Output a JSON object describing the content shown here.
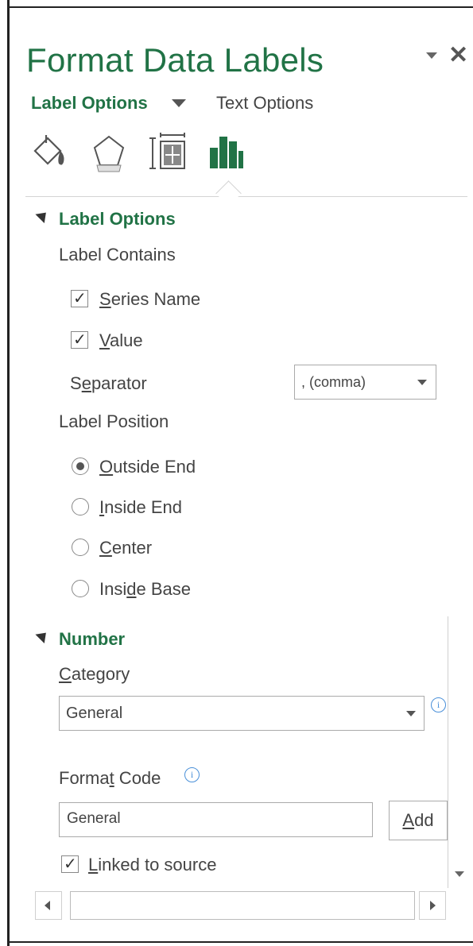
{
  "pane": {
    "title": "Format Data Labels",
    "close_glyph": "✕",
    "dropdown_icon": "chevron-down-icon"
  },
  "tabs": {
    "label_options": "Label Options",
    "text_options": "Text Options"
  },
  "icons": [
    "fill-line-icon",
    "effects-icon",
    "size-properties-icon",
    "label-options-icon"
  ],
  "colors": {
    "accent": "#217346",
    "info": "#4a90d9"
  },
  "label_options_section": {
    "title": "Label Options",
    "label_contains": "Label Contains",
    "series_name": {
      "pre": "",
      "ul": "S",
      "post": "eries Name",
      "checked": true
    },
    "value": {
      "pre": "",
      "ul": "V",
      "post": "alue",
      "checked": true
    },
    "separator": {
      "pre": "S",
      "ul": "e",
      "post": "parator",
      "value": ", (comma)"
    },
    "label_position": "Label Position",
    "positions": [
      {
        "pre": "",
        "ul": "O",
        "post": "utside End",
        "selected": true
      },
      {
        "pre": "",
        "ul": "I",
        "post": "nside End",
        "selected": false
      },
      {
        "pre": "",
        "ul": "C",
        "post": "enter",
        "selected": false
      },
      {
        "pre": "Insi",
        "ul": "d",
        "post": "e Base",
        "selected": false
      }
    ]
  },
  "number_section": {
    "title": "Number",
    "category": {
      "pre": "",
      "ul": "C",
      "post": "ategory",
      "value": "General"
    },
    "format_code": {
      "pre": "Forma",
      "ul": "t",
      "post": " Code",
      "value": "General"
    },
    "add_button": {
      "pre": "",
      "ul": "A",
      "post": "dd"
    },
    "linked": {
      "pre": "",
      "ul": "L",
      "post": "inked to source",
      "checked": true
    }
  },
  "info_glyph": "i",
  "check_glyph": "✓"
}
